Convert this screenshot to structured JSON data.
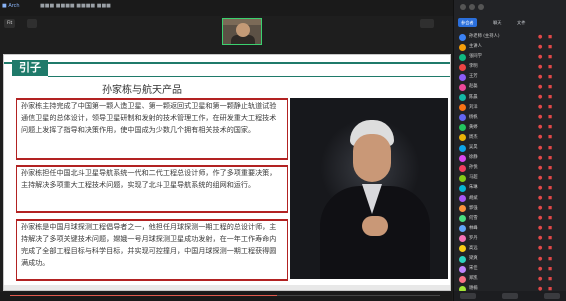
{
  "window": {
    "share_status": "■ Arch",
    "title": "■■■ ■■■■ ■■■■ ■■■"
  },
  "toolbar": {
    "view_label": "Fit"
  },
  "slide": {
    "section_tag": "引子",
    "title": "孙家栋与航天产品",
    "para1": "孙家栋主持完成了中国第一颗人造卫星、第一颗返回式卫星和第一颗静止轨道试验通信卫星的总体设计，领导卫星研制和发射的技术管理工作，在研发重大工程技术问题上发挥了指导和决策作用，使中国成为少数几个拥有相关技术的国家。",
    "para2": "孙家栋担任中国北斗卫星导航系统一代和二代工程总设计师，作了多项重要决策，主持解决多项重大工程技术问题，实现了北斗卫星导航系统的组网和运行。",
    "para3": "孙家栋是中国月球探测工程倡导者之一，他担任月球探测一期工程的总设计师，主持解决了多项关键技术问题，嫦娥一号月球探测卫星成功发射，在一年工作寿命内完成了全部工程目标与科学目标，并实现可控撞月，中国月球探测一期工程获得圆满成功。"
  },
  "playback": {
    "progress": 0.62
  },
  "panel": {
    "tabs": [
      "参会者",
      "聊天",
      "文件"
    ],
    "participants": [
      {
        "name": "孙老师 (主持人)",
        "color": "#3b82f6",
        "mic": "●",
        "cam": "◼"
      },
      {
        "name": "主讲人",
        "color": "#f59e0b",
        "mic": "●",
        "cam": "◼"
      },
      {
        "name": "张同学",
        "color": "#10b981",
        "mic": "●",
        "cam": "◼"
      },
      {
        "name": "李明",
        "color": "#ef4444",
        "mic": "●",
        "cam": "◼"
      },
      {
        "name": "王芳",
        "color": "#8b5cf6",
        "mic": "●",
        "cam": "◼"
      },
      {
        "name": "赵磊",
        "color": "#ec4899",
        "mic": "●",
        "cam": "◼"
      },
      {
        "name": "陈晨",
        "color": "#14b8a6",
        "mic": "●",
        "cam": "◼"
      },
      {
        "name": "刘洋",
        "color": "#f97316",
        "mic": "●",
        "cam": "◼"
      },
      {
        "name": "杨帆",
        "color": "#6366f1",
        "mic": "●",
        "cam": "◼"
      },
      {
        "name": "黄婷",
        "color": "#22c55e",
        "mic": "●",
        "cam": "◼"
      },
      {
        "name": "周杰",
        "color": "#eab308",
        "mic": "●",
        "cam": "◼"
      },
      {
        "name": "吴昊",
        "color": "#0ea5e9",
        "mic": "●",
        "cam": "◼"
      },
      {
        "name": "徐静",
        "color": "#d946ef",
        "mic": "●",
        "cam": "◼"
      },
      {
        "name": "孙悦",
        "color": "#f43f5e",
        "mic": "●",
        "cam": "◼"
      },
      {
        "name": "马超",
        "color": "#84cc16",
        "mic": "●",
        "cam": "◼"
      },
      {
        "name": "朱琳",
        "color": "#06b6d4",
        "mic": "●",
        "cam": "◼"
      },
      {
        "name": "胡斌",
        "color": "#a855f7",
        "mic": "●",
        "cam": "◼"
      },
      {
        "name": "郭强",
        "color": "#fb923c",
        "mic": "●",
        "cam": "◼"
      },
      {
        "name": "何雪",
        "color": "#4ade80",
        "mic": "●",
        "cam": "◼"
      },
      {
        "name": "林峰",
        "color": "#60a5fa",
        "mic": "●",
        "cam": "◼"
      },
      {
        "name": "罗丹",
        "color": "#f472b6",
        "mic": "●",
        "cam": "◼"
      },
      {
        "name": "高远",
        "color": "#facc15",
        "mic": "●",
        "cam": "◼"
      },
      {
        "name": "梁爽",
        "color": "#2dd4bf",
        "mic": "●",
        "cam": "◼"
      },
      {
        "name": "宋佳",
        "color": "#c084fc",
        "mic": "●",
        "cam": "◼"
      },
      {
        "name": "郑凯",
        "color": "#fb7185",
        "mic": "●",
        "cam": "◼"
      },
      {
        "name": "谢楠",
        "color": "#a3e635",
        "mic": "●",
        "cam": "◼"
      }
    ]
  }
}
